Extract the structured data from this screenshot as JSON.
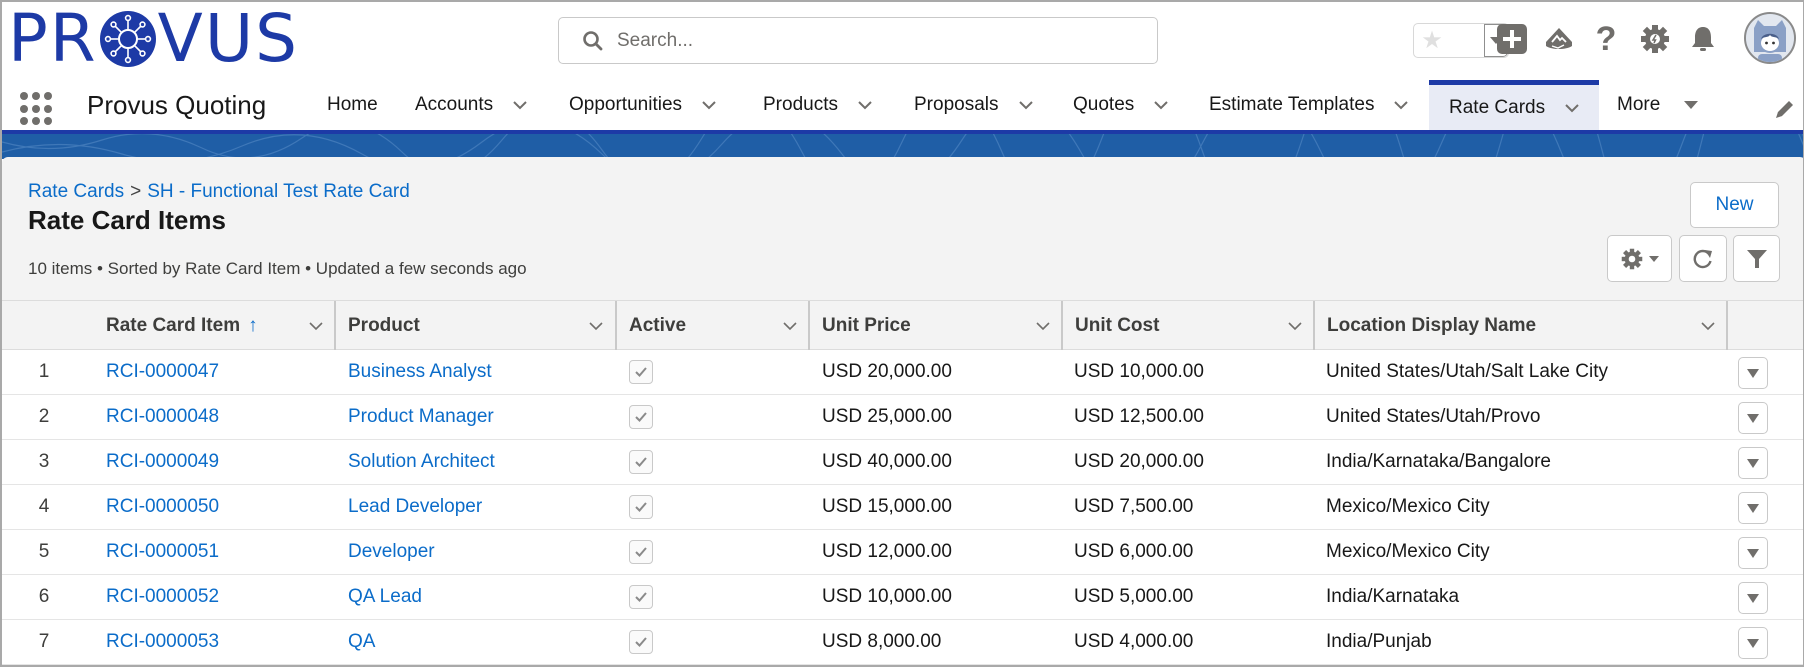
{
  "header": {
    "logo_text_left": "PR",
    "logo_text_right": "VUS",
    "search": {
      "placeholder": "Search..."
    },
    "icons": [
      "favorites-star-icon",
      "favorites-dropdown-icon",
      "global-add-icon",
      "trailhead-icon",
      "help-icon",
      "setup-gear-icon",
      "notifications-bell-icon",
      "user-avatar"
    ]
  },
  "nav": {
    "app_name": "Provus Quoting",
    "tabs": [
      {
        "label": "Home",
        "has_menu": false,
        "active": false
      },
      {
        "label": "Accounts",
        "has_menu": true,
        "active": false
      },
      {
        "label": "Opportunities",
        "has_menu": true,
        "active": false
      },
      {
        "label": "Products",
        "has_menu": true,
        "active": false
      },
      {
        "label": "Proposals",
        "has_menu": true,
        "active": false
      },
      {
        "label": "Quotes",
        "has_menu": true,
        "active": false
      },
      {
        "label": "Estimate Templates",
        "has_menu": true,
        "active": false
      },
      {
        "label": "Rate Cards",
        "has_menu": true,
        "active": true
      },
      {
        "label": "More",
        "has_menu": true,
        "active": false
      }
    ]
  },
  "page": {
    "breadcrumb": [
      {
        "label": "Rate Cards"
      },
      {
        "label": "SH - Functional Test Rate Card"
      }
    ],
    "breadcrumb_separator": ">",
    "title": "Rate Card Items",
    "meta": "10 items • Sorted by Rate Card Item • Updated a few seconds ago",
    "new_button": "New"
  },
  "table": {
    "columns": [
      {
        "label": "Rate Card Item",
        "sorted": "asc"
      },
      {
        "label": "Product"
      },
      {
        "label": "Active"
      },
      {
        "label": "Unit Price"
      },
      {
        "label": "Unit Cost"
      },
      {
        "label": "Location Display Name"
      }
    ],
    "sort_indicator": "↑",
    "rows": [
      {
        "num": "1",
        "item": "RCI-0000047",
        "product": "Business Analyst",
        "active": true,
        "unit_price": "USD 20,000.00",
        "unit_cost": "USD 10,000.00",
        "location": "United States/Utah/Salt Lake City"
      },
      {
        "num": "2",
        "item": "RCI-0000048",
        "product": "Product Manager",
        "active": true,
        "unit_price": "USD 25,000.00",
        "unit_cost": "USD 12,500.00",
        "location": "United States/Utah/Provo"
      },
      {
        "num": "3",
        "item": "RCI-0000049",
        "product": "Solution Architect",
        "active": true,
        "unit_price": "USD 40,000.00",
        "unit_cost": "USD 20,000.00",
        "location": "India/Karnataka/Bangalore"
      },
      {
        "num": "4",
        "item": "RCI-0000050",
        "product": "Lead Developer",
        "active": true,
        "unit_price": "USD 15,000.00",
        "unit_cost": "USD 7,500.00",
        "location": "Mexico/Mexico City"
      },
      {
        "num": "5",
        "item": "RCI-0000051",
        "product": "Developer",
        "active": true,
        "unit_price": "USD 12,000.00",
        "unit_cost": "USD 6,000.00",
        "location": "Mexico/Mexico City"
      },
      {
        "num": "6",
        "item": "RCI-0000052",
        "product": "QA Lead",
        "active": true,
        "unit_price": "USD 10,000.00",
        "unit_cost": "USD 5,000.00",
        "location": "India/Karnataka"
      },
      {
        "num": "7",
        "item": "RCI-0000053",
        "product": "QA",
        "active": true,
        "unit_price": "USD 8,000.00",
        "unit_cost": "USD 4,000.00",
        "location": "India/Punjab"
      }
    ]
  },
  "colors": {
    "brand": "#1d3aa6",
    "link": "#0b6cc9",
    "banner": "#1f5ea6",
    "active_tab_bg": "#e8ebf5"
  }
}
